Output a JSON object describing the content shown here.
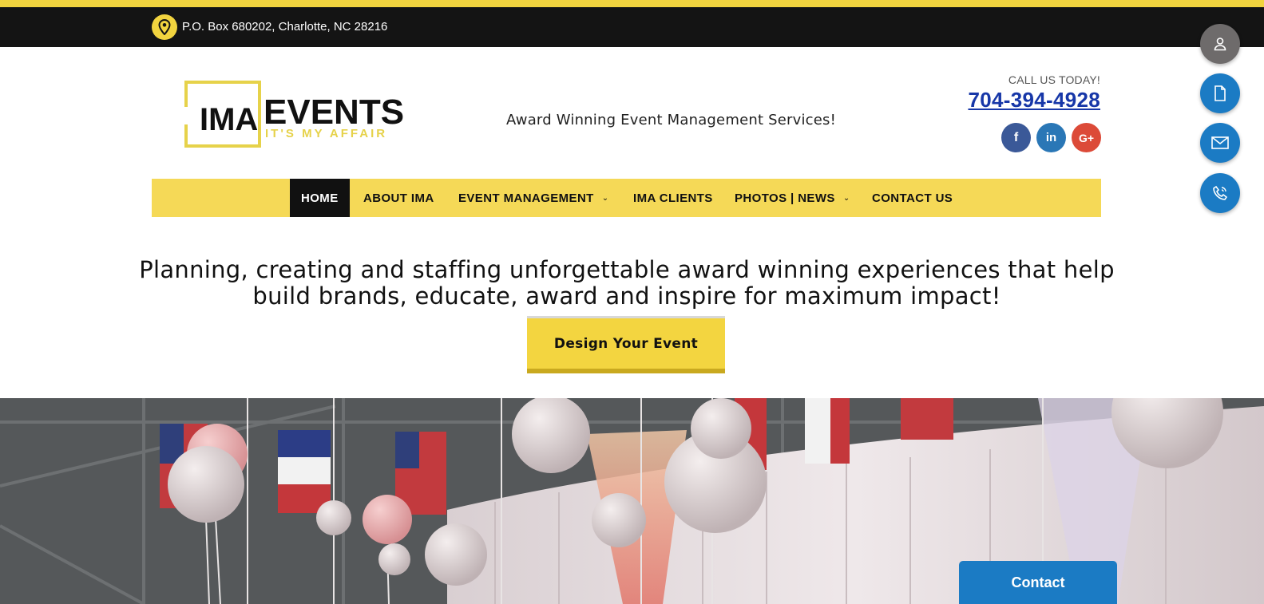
{
  "topbar": {
    "address": "P.O. Box 680202, Charlotte, NC 28216"
  },
  "header": {
    "logo_main": "EVENTS",
    "logo_sub": "IT'S MY AFFAIR",
    "logo_mark": "IMA",
    "tagline": "Award Winning Event Management Services!",
    "call_label": "CALL US TODAY!",
    "phone": "704-394-4928",
    "social": {
      "facebook": "f",
      "linkedin": "in",
      "google": "G+"
    }
  },
  "nav": {
    "items": [
      {
        "label": "HOME"
      },
      {
        "label": "ABOUT IMA"
      },
      {
        "label": "EVENT MANAGEMENT"
      },
      {
        "label": "IMA CLIENTS"
      },
      {
        "label": "PHOTOS | NEWS"
      },
      {
        "label": "CONTACT US"
      }
    ]
  },
  "hero_text": {
    "line1": "Planning, creating and staffing unforgettable award winning experiences that help",
    "line2": "build brands, educate, award and inspire for maximum impact!",
    "cta": "Design Your Event"
  },
  "floating": {
    "contact": "Contact"
  },
  "colors": {
    "accent": "#f2d43f",
    "dark": "#141414",
    "link": "#1737a8",
    "fab_blue": "#1b7bc4"
  }
}
